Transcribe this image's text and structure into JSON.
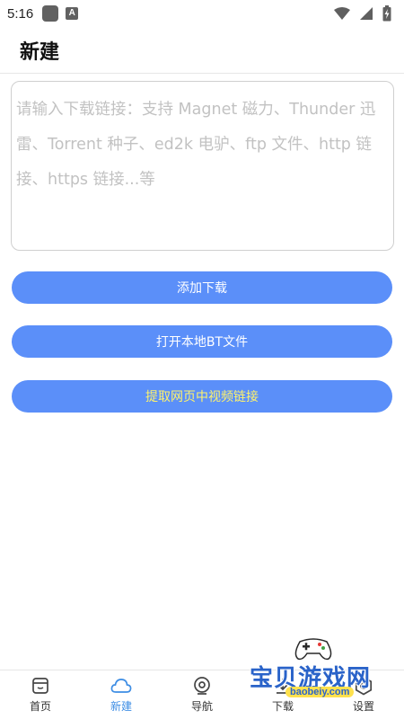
{
  "status_bar": {
    "time": "5:16",
    "a_icon": "A",
    "icons": [
      "app-icon",
      "a-notification-icon",
      "wifi-icon",
      "signal-icon",
      "battery-icon"
    ]
  },
  "header": {
    "title": "新建"
  },
  "link_input": {
    "value": "",
    "placeholder": "请输入下载链接：支持 Magnet 磁力、Thunder 迅雷、Torrent 种子、ed2k 电驴、ftp 文件、http 链接、https 链接...等"
  },
  "buttons": {
    "add_download": "添加下载",
    "open_local_bt": "打开本地BT文件",
    "extract_video_link": "提取网页中视频链接"
  },
  "colors": {
    "primary": "#5b8ff9",
    "accent_text": "#fff36b",
    "nav_active": "#3d8de4"
  },
  "bottom_nav": {
    "items": [
      {
        "label": "首页",
        "icon": "home-icon"
      },
      {
        "label": "新建",
        "icon": "cloud-icon",
        "active": true
      },
      {
        "label": "导航",
        "icon": "compass-icon"
      },
      {
        "label": "下载",
        "icon": "download-icon"
      },
      {
        "label": "设置",
        "icon": "gear-icon"
      }
    ]
  },
  "watermark": {
    "title": "宝贝游戏网",
    "url": "baobeiy.com"
  }
}
